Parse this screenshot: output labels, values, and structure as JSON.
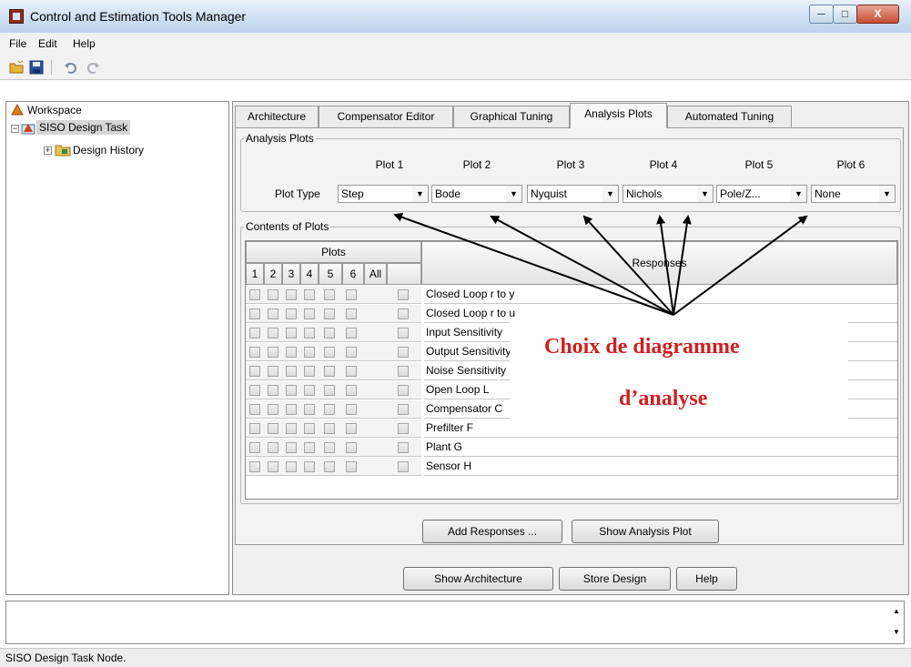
{
  "window": {
    "title": "Control and Estimation Tools Manager"
  },
  "menu": [
    "File",
    "Edit",
    "Help"
  ],
  "tree": {
    "workspace": "Workspace",
    "task": "SISO Design Task",
    "history": "Design History"
  },
  "tabs": [
    "Architecture",
    "Compensator Editor",
    "Graphical Tuning",
    "Analysis Plots",
    "Automated Tuning"
  ],
  "active_tab": "Analysis Plots",
  "analysis_plots": {
    "group_title": "Analysis Plots",
    "plot_type_label": "Plot Type",
    "plots": [
      {
        "header": "Plot 1",
        "value": "Step"
      },
      {
        "header": "Plot 2",
        "value": "Bode"
      },
      {
        "header": "Plot 3",
        "value": "Nyquist"
      },
      {
        "header": "Plot 4",
        "value": "Nichols"
      },
      {
        "header": "Plot 5",
        "value": "Pole/Z..."
      },
      {
        "header": "Plot 6",
        "value": "None"
      }
    ]
  },
  "contents": {
    "group_title": "Contents of Plots",
    "plots_header": "Plots",
    "columns": [
      "1",
      "2",
      "3",
      "4",
      "5",
      "6",
      "All"
    ],
    "responses_header": "Responses",
    "rows": [
      "Closed Loop r to y",
      "Closed Loop r to u",
      "Input Sensitivity",
      "Output Sensitivity",
      "Noise Sensitivity",
      "Open Loop L",
      "Compensator C",
      "Prefilter F",
      "Plant G",
      "Sensor H"
    ]
  },
  "buttons": {
    "add_responses": "Add Responses ...",
    "show_analysis_plot": "Show Analysis Plot",
    "show_architecture": "Show Architecture",
    "store_design": "Store Design",
    "help": "Help"
  },
  "annotation": {
    "line1": "Choix de diagramme",
    "line2": "d’analyse",
    "color": "#d21f1f"
  },
  "status": "SISO Design Task Node."
}
